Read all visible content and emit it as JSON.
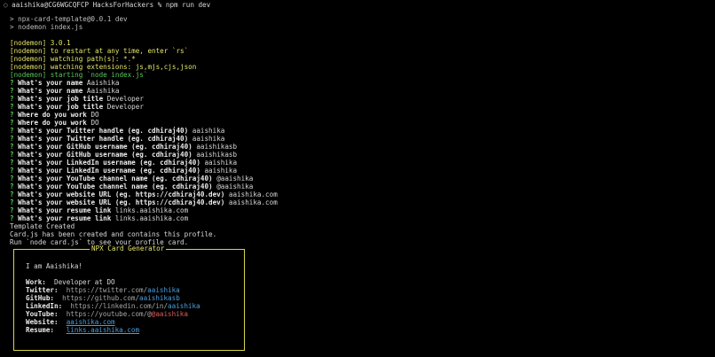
{
  "prompt": {
    "circle": "○",
    "text": "aaishika@CG6WGCQFCP HacksForHackers % npm run dev"
  },
  "npm_output": [
    "> npx-card-template@0.0.1 dev",
    "> nodemon index.js"
  ],
  "nodemon": {
    "version": "[nodemon] 3.0.1",
    "restart": "[nodemon] to restart at any time, enter `rs`",
    "watching_paths": "[nodemon] watching path(s): *.*",
    "watching_ext": "[nodemon] watching extensions: js,mjs,cjs,json",
    "starting": "[nodemon] starting `node index.js`"
  },
  "qa": [
    {
      "q": "What's your name",
      "a": "Aaishika"
    },
    {
      "q": "What's your name",
      "a": "Aaishika"
    },
    {
      "q": "What's your job title",
      "a": "Developer"
    },
    {
      "q": "What's your job title",
      "a": "Developer"
    },
    {
      "q": "Where do you work",
      "a": "DO"
    },
    {
      "q": "Where do you work",
      "a": "DO"
    },
    {
      "q": "What's your Twitter handle (eg. cdhiraj40)",
      "a": "aaishika"
    },
    {
      "q": "What's your Twitter handle (eg. cdhiraj40)",
      "a": "aaishika"
    },
    {
      "q": "What's your GitHub username (eg. cdhiraj40)",
      "a": "aaishikasb"
    },
    {
      "q": "What's your GitHub username (eg. cdhiraj40)",
      "a": "aaishikasb"
    },
    {
      "q": "What's your LinkedIn username (eg. cdhiraj40)",
      "a": "aaishika"
    },
    {
      "q": "What's your LinkedIn username (eg. cdhiraj40)",
      "a": "aaishika"
    },
    {
      "q": "What's your YouTube channel name (eg. cdhiraj40)",
      "a": "@aaishika"
    },
    {
      "q": "What's your YouTube channel name (eg. cdhiraj40)",
      "a": "@aaishika"
    },
    {
      "q": "What's your website URL (eg. https://cdhiraj40.dev)",
      "a": "aaishika.com"
    },
    {
      "q": "What's your website URL (eg. https://cdhiraj40.dev)",
      "a": "aaishika.com"
    },
    {
      "q": "What's your resume link",
      "a": "links.aaishika.com"
    },
    {
      "q": "What's your resume link",
      "a": "links.aaishika.com"
    }
  ],
  "result": [
    "Template Created",
    "Card.js has been created and contains this profile.",
    "Run `node card.js` to see your profile card."
  ],
  "card": {
    "title": "NPX Card Generator",
    "greeting": "I am Aaishika!",
    "work_label": "Work:",
    "work_value": "Developer at DO",
    "twitter_label": "Twitter:",
    "twitter_prefix": "https://twitter.com/",
    "twitter_user": "aaishika",
    "github_label": "GitHub:",
    "github_prefix": "https://github.com/",
    "github_user": "aaishikasb",
    "linkedin_label": "LinkedIn:",
    "linkedin_prefix": "https://linkedin.com/in/",
    "linkedin_user": "aaishika",
    "youtube_label": "YouTube:",
    "youtube_prefix": "https://youtube.com/@",
    "youtube_user": "@aaishika",
    "website_label": "Website:",
    "website_value": "aaishika.com",
    "resume_label": "Resume:",
    "resume_value": "links.aaishika.com"
  },
  "colors": {
    "background": "#000000",
    "nodemon_yellow": "#e5e56a",
    "nodemon_green": "#59c759",
    "card_border": "#d6d64a",
    "link_blue": "#4a9fe0",
    "youtube_red": "#e05a5a"
  }
}
